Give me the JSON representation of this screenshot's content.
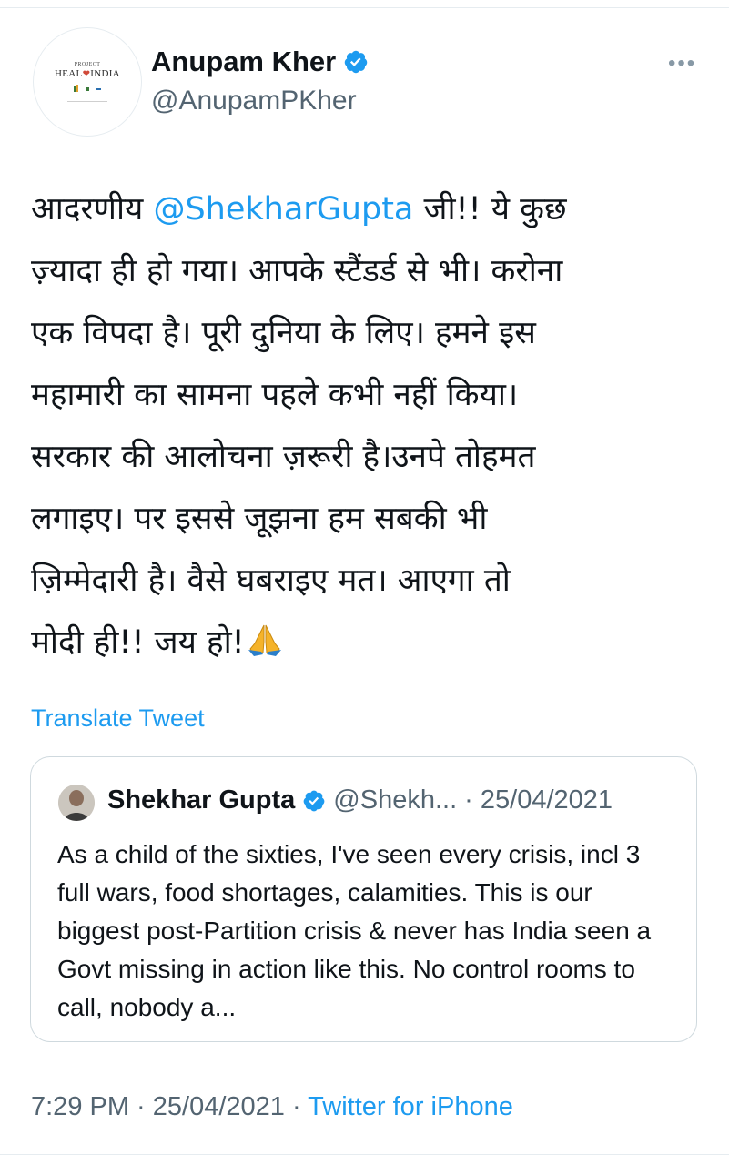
{
  "author": {
    "name": "Anupam Kher",
    "handle": "@AnupamPKher",
    "avatar_logo": {
      "line1": "PROJECT",
      "line2": "HEAL INDIA"
    }
  },
  "more_menu": "•••",
  "tweet": {
    "lines": [
      {
        "pre": "आदरणीय ",
        "mention": "@ShekharGupta",
        "post": " जी!! ये कुछ"
      },
      {
        "text": "ज़्यादा ही हो गया। आपके स्टैंडर्ड से भी। करोना"
      },
      {
        "text": "एक विपदा है। पूरी दुनिया के लिए। हमने इस"
      },
      {
        "text": "महामारी का सामना पहले कभी नहीं किया।"
      },
      {
        "text": "सरकार की आलोचना ज़रूरी है।उनपे तोहमत"
      },
      {
        "text": "लगाइए। पर इससे जूझना हम सबकी भी"
      },
      {
        "text": "ज़िम्मेदारी है। वैसे घबराइए मत। आएगा तो"
      },
      {
        "text": "मोदी ही!! जय हो!"
      }
    ],
    "emoji": "folded-hands-icon"
  },
  "translate_label": "Translate Tweet",
  "quoted": {
    "name": "Shekhar Gupta",
    "handle_date": "@Shekh... · 25/04/2021",
    "text": "As a child of the sixties, I've seen every crisis, incl 3 full wars, food shortages, calamities. This is our biggest post-Partition crisis & never has India seen a Govt missing in action like this. No control rooms to call, nobody a..."
  },
  "meta": {
    "time_date": "7:29 PM · 25/04/2021 · ",
    "source": "Twitter for iPhone"
  },
  "colors": {
    "accent": "#1d9bf0",
    "secondary_text": "#536471",
    "border": "#cfd9de"
  }
}
